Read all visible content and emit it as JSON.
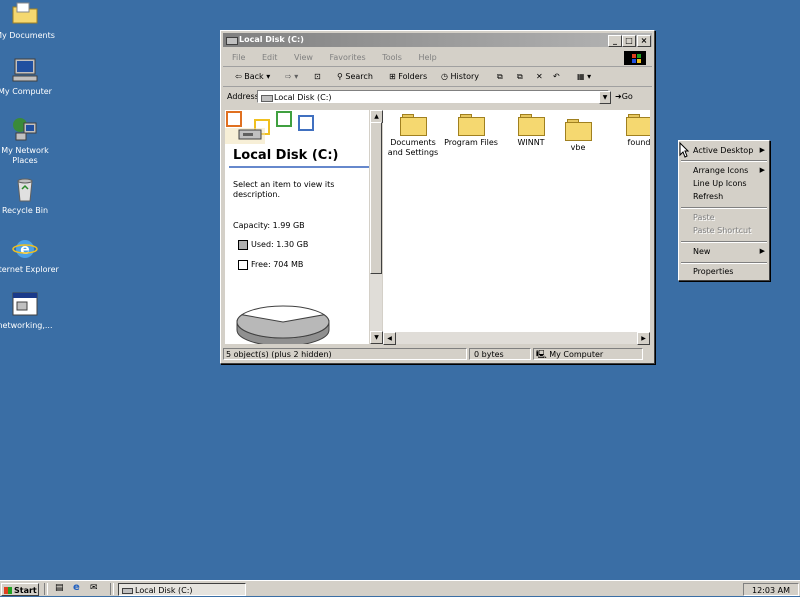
{
  "desktop": {
    "icons": [
      {
        "label": "My Documents"
      },
      {
        "label": "My Computer"
      },
      {
        "label": "My Network Places"
      },
      {
        "label": "Recycle Bin"
      },
      {
        "label": "Internet Explorer"
      },
      {
        "label": "networking,..."
      }
    ]
  },
  "window": {
    "title": "Local Disk (C:)",
    "menu": [
      "File",
      "Edit",
      "View",
      "Favorites",
      "Tools",
      "Help"
    ],
    "toolbar": {
      "back": "Back",
      "search": "Search",
      "folders": "Folders",
      "history": "History"
    },
    "address": {
      "label": "Address",
      "value": "Local Disk (C:)",
      "go": "Go"
    },
    "info_pane": {
      "title": "Local Disk (C:)",
      "description": "Select an item to view its description.",
      "capacity": "Capacity: 1.99 GB",
      "used": "Used: 1.30 GB",
      "free": "Free: 704 MB",
      "used_fraction": 0.65
    },
    "files": [
      {
        "name": "Documents and Settings"
      },
      {
        "name": "Program Files"
      },
      {
        "name": "WINNT"
      },
      {
        "name": "vbe"
      },
      {
        "name": "found"
      }
    ],
    "status": {
      "objects": "5 object(s) (plus 2 hidden)",
      "size": "0 bytes",
      "zone": "My Computer"
    }
  },
  "context_menu": {
    "items": [
      {
        "label": "Active Desktop",
        "submenu": true,
        "enabled": true
      },
      {
        "label": "Arrange Icons",
        "submenu": true,
        "enabled": true
      },
      {
        "label": "Line Up Icons",
        "enabled": true
      },
      {
        "label": "Refresh",
        "enabled": true
      },
      {
        "label": "Paste",
        "enabled": false
      },
      {
        "label": "Paste Shortcut",
        "enabled": false
      },
      {
        "label": "New",
        "submenu": true,
        "enabled": true
      },
      {
        "label": "Properties",
        "enabled": true
      }
    ]
  },
  "taskbar": {
    "start": "Start",
    "task": "Local Disk (C:)",
    "clock": "12:03 AM"
  },
  "colors": {
    "desktop": "#3a6ea5",
    "chrome": "#d4d0c8",
    "titlebar_inactive": "#808080"
  }
}
